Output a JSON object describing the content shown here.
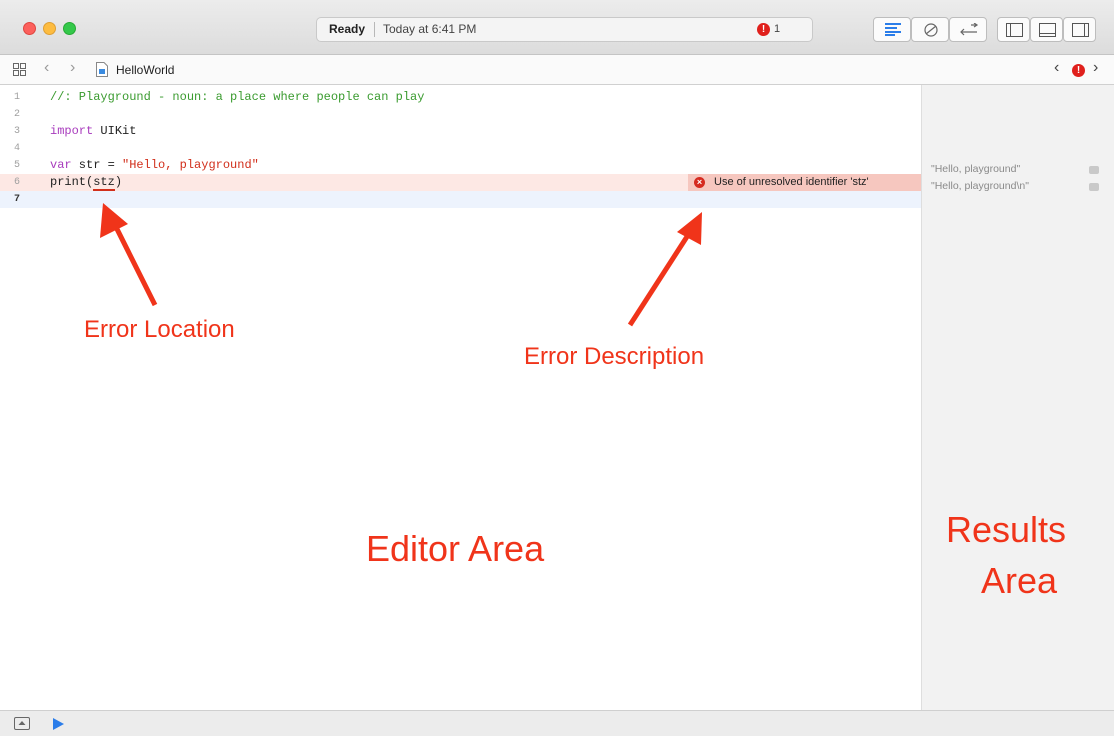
{
  "status": {
    "state": "Ready",
    "time": "Today at 6:41 PM",
    "error_count": "1"
  },
  "jumpbar": {
    "filename": "HelloWorld",
    "back": "‹",
    "forward": "›",
    "prev_issue": "‹",
    "next_issue": "›"
  },
  "error_glyph": "!",
  "editor": {
    "lines": [
      {
        "num": "1",
        "code": "//: Playground - noun: a place where people can play"
      },
      {
        "num": "2",
        "code": ""
      },
      {
        "num": "3",
        "kw": "import",
        "rest": " UIKit"
      },
      {
        "num": "4",
        "code": ""
      },
      {
        "num": "5",
        "kw": "var",
        "mid": " str = ",
        "str": "\"Hello, playground\""
      },
      {
        "num": "6",
        "pre": "print(",
        "err": "stz",
        "post": ")"
      },
      {
        "num": "7",
        "code": ""
      }
    ],
    "error_message": "Use of unresolved identifier 'stz'",
    "error_icon": "×"
  },
  "results": [
    "\"Hello, playground\"",
    "\"Hello, playground\\n\""
  ],
  "annotations": {
    "error_location": "Error Location",
    "error_description": "Error Description",
    "editor_area": "Editor Area",
    "results_area_1": "Results",
    "results_area_2": "Area"
  },
  "colors": {
    "annotation": "#f0341a",
    "error_line_bg": "#fde8e4",
    "error_badge_bg": "#f6c7bf",
    "current_line_bg": "#edf3fd",
    "run_button": "#2b7de9"
  },
  "icons": {
    "window_controls": [
      "close-icon",
      "minimize-icon",
      "zoom-icon"
    ],
    "toolbar": [
      "standard-editor-icon",
      "assistant-editor-icon",
      "version-editor-icon",
      "navigator-toggle-icon",
      "debug-area-toggle-icon",
      "utilities-toggle-icon"
    ],
    "bottom": [
      "console-toggle-icon",
      "run-icon"
    ]
  }
}
